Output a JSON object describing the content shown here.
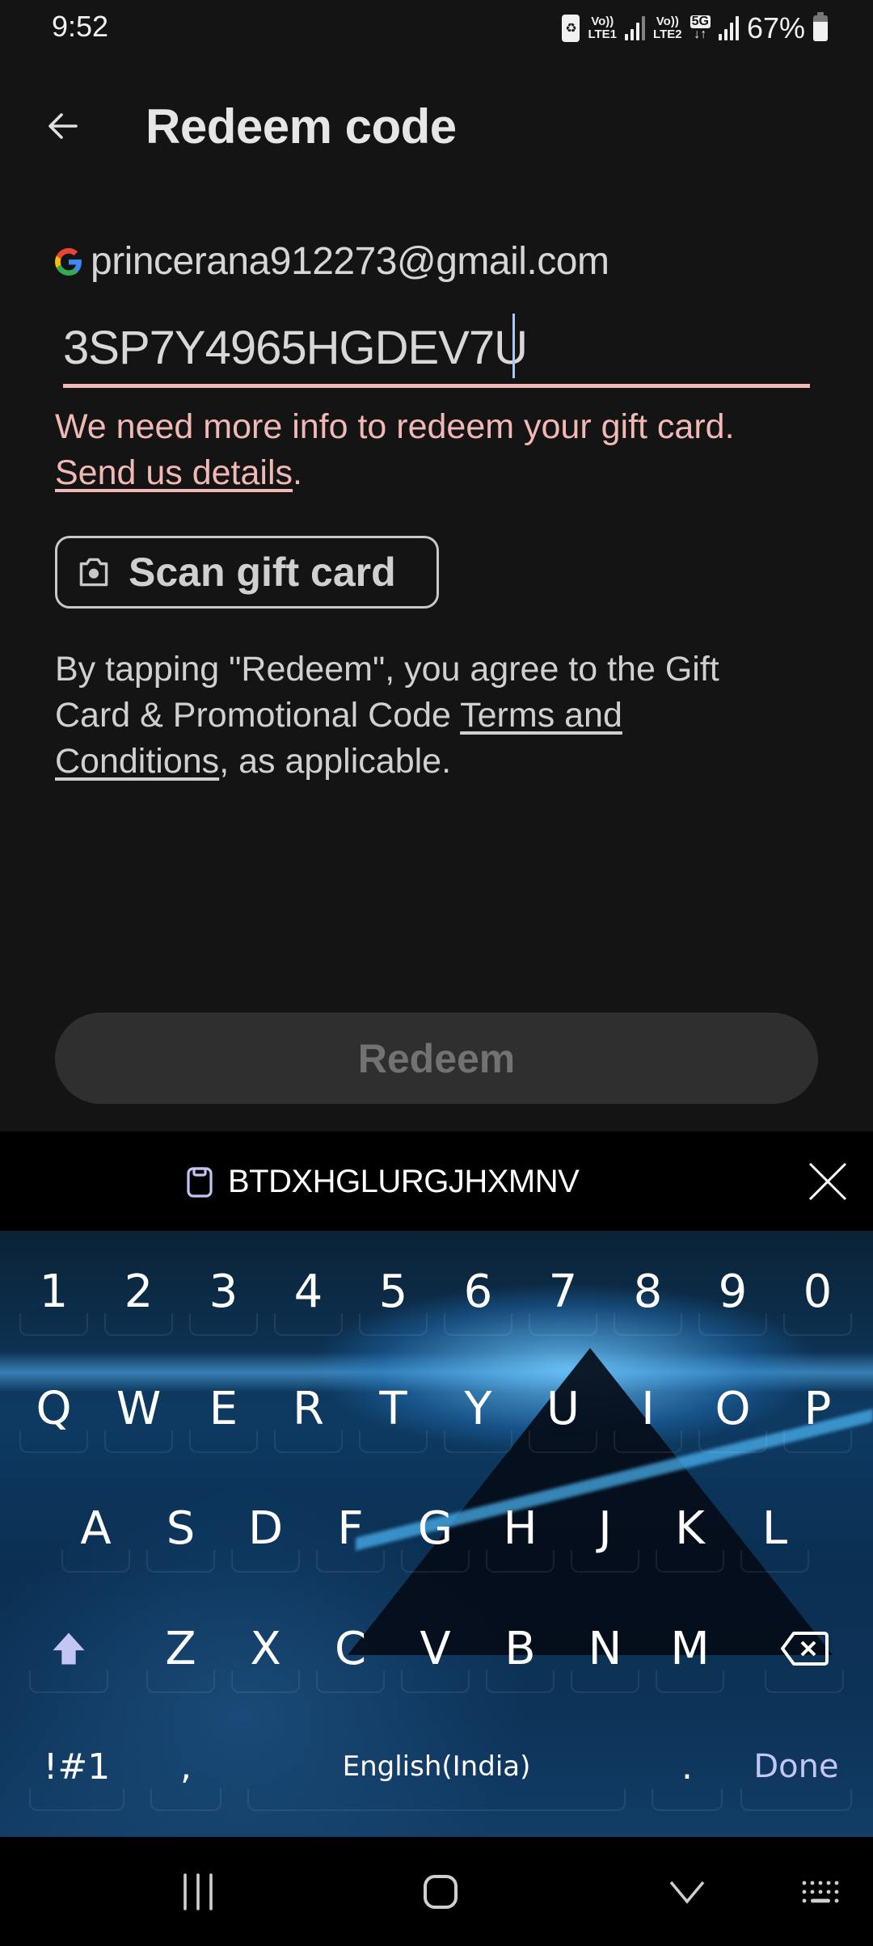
{
  "status_bar": {
    "time": "9:52",
    "sim1_label_top": "Vo))",
    "sim1_label_bottom": "LTE1",
    "sim2_label_top": "Vo))",
    "sim2_label_bottom": "LTE2",
    "network_type": "5G",
    "data_arrows": "↓↑",
    "battery_percent": "67%",
    "battery_level": 0.67
  },
  "app_bar": {
    "title": "Redeem code",
    "back_icon": "arrow-back-icon"
  },
  "account": {
    "email": "princerana912273@gmail.com",
    "icon": "google-g-icon"
  },
  "code_input": {
    "value": "3SP7Y4965HGDEV7U",
    "placeholder": ""
  },
  "error": {
    "message": "We need more info to redeem your gift card.",
    "link": "Send us details",
    "suffix": "."
  },
  "scan_button": {
    "label": "Scan gift card",
    "icon": "camera-icon"
  },
  "terms": {
    "prefix": "By tapping \"Redeem\", you agree to the Gift Card & Promotional Code ",
    "link": "Terms and Conditions",
    "suffix": ", as applicable."
  },
  "redeem_button": {
    "label": "Redeem",
    "enabled": false
  },
  "clipboard": {
    "suggestion": "BTDXHGLURGJHXMNV",
    "icon": "clipboard-icon",
    "close_icon": "close-icon"
  },
  "keyboard": {
    "number_row": [
      "1",
      "2",
      "3",
      "4",
      "5",
      "6",
      "7",
      "8",
      "9",
      "0"
    ],
    "row1": [
      "Q",
      "W",
      "E",
      "R",
      "T",
      "Y",
      "U",
      "I",
      "O",
      "P"
    ],
    "row2": [
      "A",
      "S",
      "D",
      "F",
      "G",
      "H",
      "J",
      "K",
      "L"
    ],
    "row3": [
      "Z",
      "X",
      "C",
      "V",
      "B",
      "N",
      "M"
    ],
    "shift_icon": "shift-icon",
    "backspace_icon": "backspace-icon",
    "symbols_label": "!#1",
    "comma_label": ",",
    "space_label": "English(India)",
    "period_label": ".",
    "done_label": "Done",
    "accent_color": "#c3c6f5"
  },
  "nav_bar": {
    "recents_icon": "recents-icon",
    "home_icon": "home-icon",
    "hide_keyboard_icon": "chevron-down-icon",
    "keyboard_switch_icon": "keyboard-icon"
  },
  "colors": {
    "background": "#141414",
    "error": "#f2b8b5",
    "caret": "#a8c7fa",
    "redeem_disabled_bg": "#2f2f2f",
    "redeem_disabled_text": "#727272"
  }
}
